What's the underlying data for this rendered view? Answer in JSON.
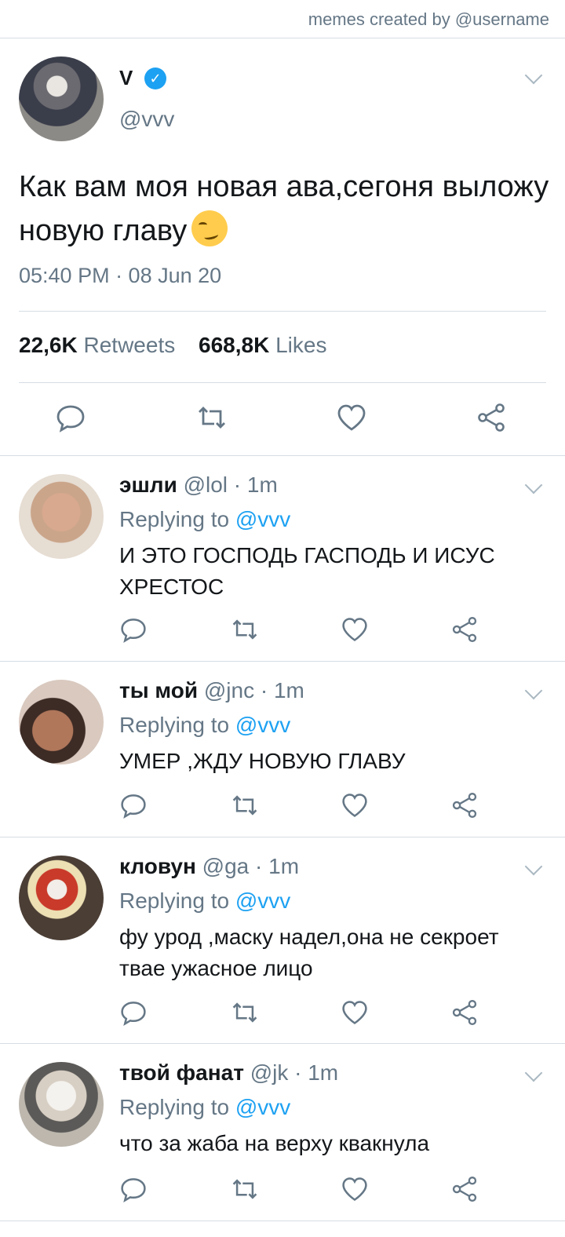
{
  "watermark": "memes created by @username",
  "main": {
    "name": "V",
    "handle": "@vvv",
    "text": "Как вам моя новая ава,сегоня выложу новую главу",
    "emoji": "smirk-emoji",
    "time": "05:40 PM · 08 Jun 20",
    "retweets_count": "22,6K",
    "retweets_label": "Retweets",
    "likes_count": "668,8K",
    "likes_label": "Likes"
  },
  "replies": [
    {
      "name": "эшли",
      "meta": "@lol · 1m",
      "replying_prefix": "Replying to",
      "replying_to": "@vvv",
      "text": "И ЭТО ГОСПОДЬ ГАСПОДЬ И ИСУС ХРЕСТОС"
    },
    {
      "name": "ты мой",
      "meta": "@jnc · 1m",
      "replying_prefix": "Replying to",
      "replying_to": "@vvv",
      "text": "УМЕР ,ЖДУ НОВУЮ ГЛАВУ"
    },
    {
      "name": "кловун",
      "meta": "@ga · 1m",
      "replying_prefix": "Replying to",
      "replying_to": "@vvv",
      "text": "фу урод ,маску надел,она не секроет твае ужасное лицо"
    },
    {
      "name": "твой фанат",
      "meta": "@jk · 1m",
      "replying_prefix": "Replying to",
      "replying_to": "@vvv",
      "text": "что за жаба на верху квакнула"
    }
  ],
  "colors": {
    "accent": "#1da1f2",
    "muted": "#657786",
    "border": "#d5dde3",
    "icon": "#657786"
  }
}
